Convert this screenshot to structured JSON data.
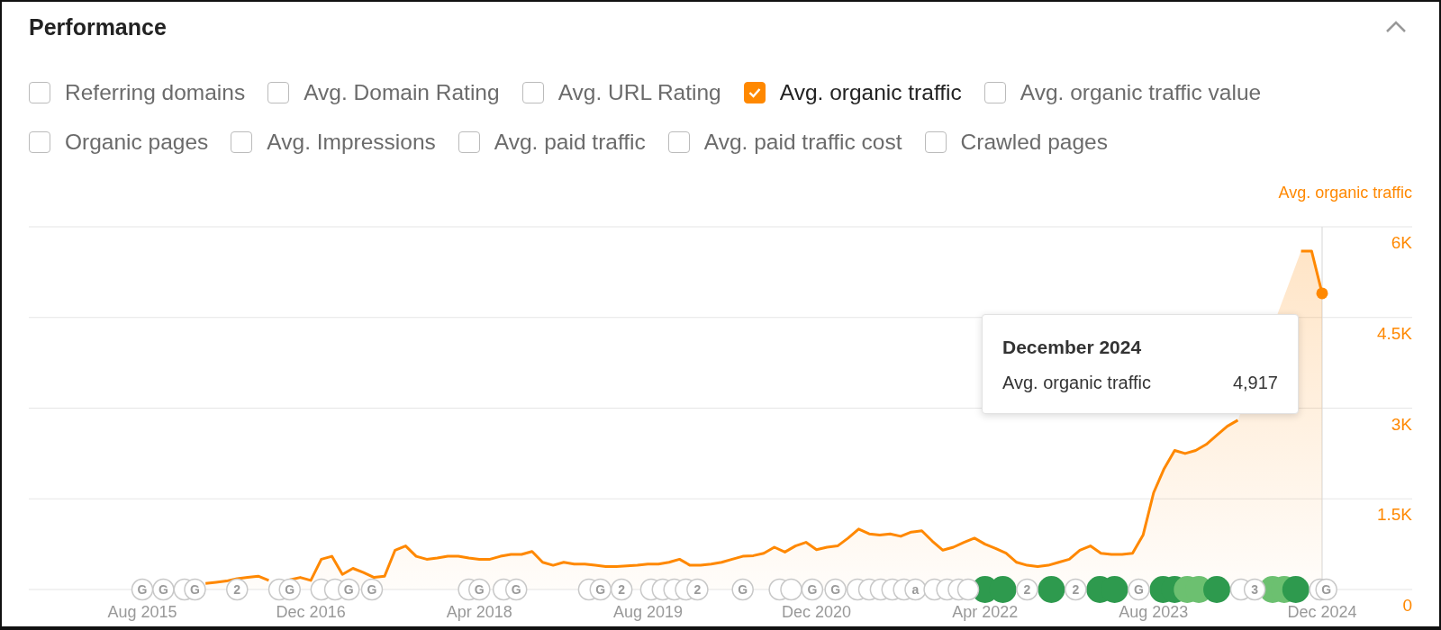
{
  "panel": {
    "title": "Performance",
    "expanded": true
  },
  "metrics": [
    {
      "label": "Referring domains",
      "checked": false
    },
    {
      "label": "Avg. Domain Rating",
      "checked": false
    },
    {
      "label": "Avg. URL Rating",
      "checked": false
    },
    {
      "label": "Avg. organic traffic",
      "checked": true
    },
    {
      "label": "Avg. organic traffic value",
      "checked": false
    },
    {
      "label": "Organic pages",
      "checked": false
    },
    {
      "label": "Avg. Impressions",
      "checked": false
    },
    {
      "label": "Avg. paid traffic",
      "checked": false
    },
    {
      "label": "Avg. paid traffic cost",
      "checked": false
    },
    {
      "label": "Crawled pages",
      "checked": false
    }
  ],
  "chart_data": {
    "type": "area",
    "categories": [
      "Aug 2015",
      null,
      null,
      null,
      null,
      null,
      null,
      null,
      null,
      null,
      null,
      null,
      null,
      null,
      null,
      null,
      "Dec 2016",
      null,
      null,
      null,
      null,
      null,
      null,
      null,
      null,
      null,
      null,
      null,
      null,
      null,
      null,
      null,
      "Apr 2018",
      null,
      null,
      null,
      null,
      null,
      null,
      null,
      null,
      null,
      null,
      null,
      null,
      null,
      null,
      null,
      "Aug 2019",
      null,
      null,
      null,
      null,
      null,
      null,
      null,
      null,
      null,
      null,
      null,
      null,
      null,
      null,
      null,
      "Dec 2020",
      null,
      null,
      null,
      null,
      null,
      null,
      null,
      null,
      null,
      null,
      null,
      null,
      null,
      null,
      null,
      "Apr 2022",
      null,
      null,
      null,
      null,
      null,
      null,
      null,
      null,
      null,
      null,
      null,
      null,
      null,
      null,
      null,
      "Aug 2023",
      null,
      null,
      null,
      null,
      null,
      null,
      null,
      null,
      null,
      null,
      null,
      null,
      null,
      null,
      null,
      "Dec 2024"
    ],
    "series": [
      {
        "name": "Avg. organic traffic",
        "color": "#ff8800",
        "values": [
          null,
          null,
          null,
          null,
          null,
          null,
          100,
          120,
          140,
          180,
          200,
          220,
          150,
          null,
          160,
          200,
          150,
          500,
          550,
          250,
          350,
          280,
          200,
          220,
          650,
          720,
          550,
          500,
          520,
          550,
          550,
          520,
          500,
          500,
          550,
          580,
          580,
          630,
          450,
          400,
          450,
          420,
          420,
          400,
          380,
          380,
          390,
          400,
          420,
          420,
          450,
          500,
          400,
          400,
          420,
          450,
          500,
          550,
          560,
          600,
          700,
          620,
          720,
          780,
          660,
          700,
          720,
          850,
          1000,
          920,
          900,
          920,
          880,
          950,
          970,
          800,
          650,
          700,
          780,
          850,
          750,
          680,
          600,
          450,
          400,
          380,
          400,
          450,
          500,
          650,
          720,
          600,
          580,
          580,
          600,
          900,
          1600,
          2000,
          2300,
          2250,
          2300,
          2400,
          2550,
          2700,
          2800,
          null,
          null,
          null,
          null,
          null,
          5600,
          5600,
          4900
        ]
      }
    ],
    "ylim": [
      0,
      6000
    ],
    "yticks": [
      {
        "value": 0,
        "label": "0"
      },
      {
        "value": 1500,
        "label": "1.5K"
      },
      {
        "value": 3000,
        "label": "3K"
      },
      {
        "value": 4500,
        "label": "4.5K"
      },
      {
        "value": 6000,
        "label": "6K"
      }
    ],
    "grid": true
  },
  "event_markers": [
    {
      "kind": "update",
      "label": "G"
    },
    {
      "kind": "update",
      "label": "G"
    },
    {
      "kind": "update"
    },
    {
      "kind": "update",
      "label": "G"
    },
    {
      "kind": "update",
      "label": "2"
    },
    {
      "kind": "update"
    },
    {
      "kind": "update",
      "label": "G"
    },
    {
      "kind": "update"
    },
    {
      "kind": "update"
    },
    {
      "kind": "update",
      "label": "G"
    },
    {
      "kind": "update",
      "label": "G"
    },
    {
      "kind": "update"
    },
    {
      "kind": "update",
      "label": "G"
    },
    {
      "kind": "update"
    },
    {
      "kind": "update",
      "label": "G"
    },
    {
      "kind": "update"
    },
    {
      "kind": "update",
      "label": "G"
    },
    {
      "kind": "update",
      "label": "2"
    },
    {
      "kind": "update"
    },
    {
      "kind": "update"
    },
    {
      "kind": "update"
    },
    {
      "kind": "update"
    },
    {
      "kind": "update",
      "label": "2"
    },
    {
      "kind": "update",
      "label": "G"
    },
    {
      "kind": "update"
    },
    {
      "kind": "update"
    },
    {
      "kind": "update",
      "label": "G"
    },
    {
      "kind": "update",
      "label": "G"
    },
    {
      "kind": "update"
    },
    {
      "kind": "update"
    },
    {
      "kind": "update"
    },
    {
      "kind": "update"
    },
    {
      "kind": "update"
    },
    {
      "kind": "update",
      "label": "a"
    },
    {
      "kind": "update"
    },
    {
      "kind": "update"
    },
    {
      "kind": "update"
    },
    {
      "kind": "update"
    },
    {
      "kind": "major"
    },
    {
      "kind": "major"
    },
    {
      "kind": "update",
      "label": "2"
    },
    {
      "kind": "major"
    },
    {
      "kind": "update",
      "label": "2"
    },
    {
      "kind": "major"
    },
    {
      "kind": "major"
    },
    {
      "kind": "update",
      "label": "G"
    },
    {
      "kind": "major"
    },
    {
      "kind": "major"
    },
    {
      "kind": "minor"
    },
    {
      "kind": "minor"
    },
    {
      "kind": "major"
    },
    {
      "kind": "update"
    },
    {
      "kind": "update",
      "label": "3"
    },
    {
      "kind": "minor"
    },
    {
      "kind": "minor"
    },
    {
      "kind": "major"
    },
    {
      "kind": "update"
    },
    {
      "kind": "update",
      "label": "G"
    }
  ],
  "tooltip": {
    "title": "December 2024",
    "label": "Avg. organic traffic",
    "value": "4,917"
  }
}
